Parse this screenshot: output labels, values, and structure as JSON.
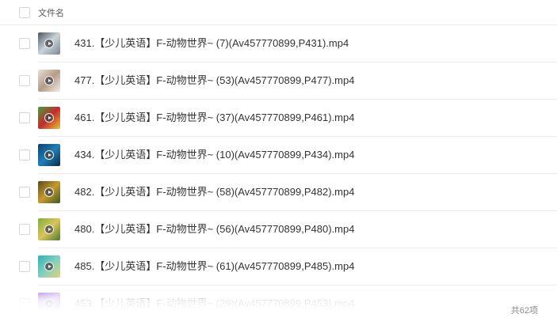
{
  "header": {
    "column_label": "文件名"
  },
  "files": [
    {
      "name": "431.【少儿英语】F-动物世界~ (7)(Av457770899,P431).mp4",
      "thumb_colors": [
        "#4a5560",
        "#c9d3da",
        "#7a8894"
      ]
    },
    {
      "name": "477.【少儿英语】F-动物世界~ (53)(Av457770899,P477).mp4",
      "thumb_colors": [
        "#e8e0d8",
        "#b69c8a",
        "#f2ece6"
      ]
    },
    {
      "name": "461.【少儿英语】F-动物世界~ (37)(Av457770899,P461).mp4",
      "thumb_colors": [
        "#3fa23a",
        "#c52b2b",
        "#e8c13a"
      ]
    },
    {
      "name": "434.【少儿英语】F-动物世界~ (10)(Av457770899,P434).mp4",
      "thumb_colors": [
        "#0e3e6a",
        "#1f7fb8",
        "#0a2a48"
      ]
    },
    {
      "name": "482.【少儿英语】F-动物世界~ (58)(Av457770899,P482).mp4",
      "thumb_colors": [
        "#5b4a1c",
        "#c79a2e",
        "#3e5a1e"
      ]
    },
    {
      "name": "480.【少儿英语】F-动物世界~ (56)(Av457770899,P480).mp4",
      "thumb_colors": [
        "#7fae3a",
        "#d9c45a",
        "#4e7a2a"
      ]
    },
    {
      "name": "485.【少儿英语】F-动物世界~ (61)(Av457770899,P485).mp4",
      "thumb_colors": [
        "#2fb0b4",
        "#7fd0c0",
        "#e2d37a"
      ]
    },
    {
      "name": "453.【少儿英语】F-动物世界~ (29)(Av457770899,P453).mp4",
      "thumb_colors": [
        "#8e5ad0",
        "#c7a7ee",
        "#5a3a90"
      ]
    }
  ],
  "footer": {
    "count_text": "共62项"
  }
}
